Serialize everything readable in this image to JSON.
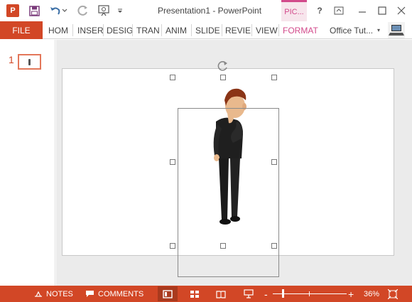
{
  "window": {
    "title": "Presentation1 - PowerPoint",
    "context_tab": "PIC...",
    "help": "?"
  },
  "quick_access": {
    "app_icon": "powerpoint-icon",
    "app_icon_text": "P",
    "save": "save-icon",
    "undo": "undo-icon",
    "redo": "redo-icon",
    "present": "start-from-beginning-icon",
    "customize": "chevron-down-icon"
  },
  "ribbon": {
    "file_label": "FILE",
    "tabs": [
      "HOM",
      "INSER",
      "DESIG",
      "TRAN",
      "ANIM",
      "SLIDE",
      "REVIE",
      "VIEW",
      "FORMAT"
    ],
    "account": "Office Tut...",
    "account_dropdown": "▾"
  },
  "thumbnail_pane": {
    "slide_number": "1"
  },
  "status_bar": {
    "notes_label": "NOTES",
    "comments_label": "COMMENTS",
    "zoom_minus": "-",
    "zoom_plus": "+",
    "zoom_level": "36%",
    "zoom_fraction": 0.36
  },
  "colors": {
    "accent": "#d24726",
    "picture_tools": "#d24a8b",
    "canvas_bg": "#ebebeb",
    "slide_bg": "#ffffff"
  }
}
